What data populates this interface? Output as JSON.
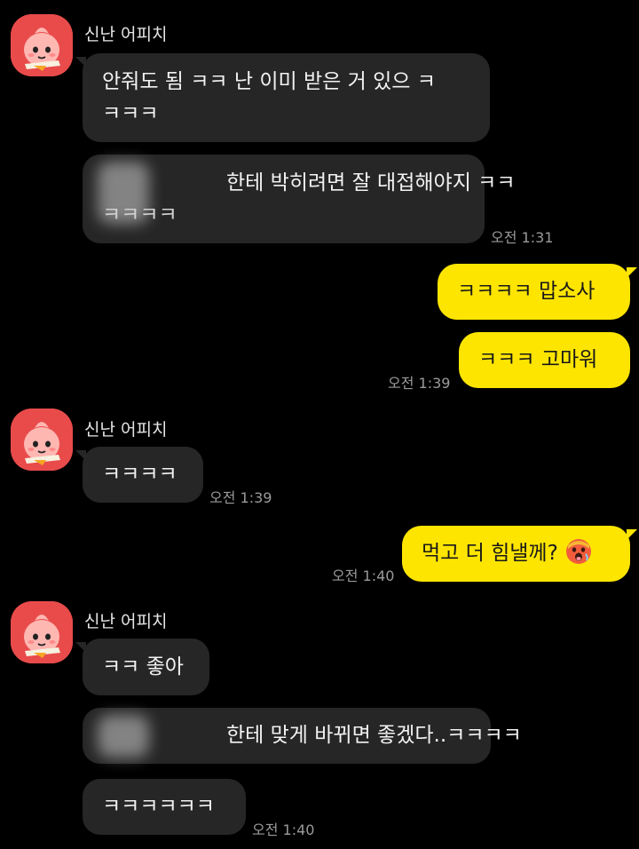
{
  "chat": {
    "sender_name": "신난 어피치",
    "messages": {
      "m1": {
        "line1": "안줘도 됨 ㅋㅋ 난 이미 받은 거 있으 ㅋ",
        "line2": "ㅋㅋㅋ"
      },
      "m2": {
        "line1": "한테 박히려면 잘 대접해야지 ㅋㅋ",
        "line2": "ㅋㅋㅋㅋ"
      },
      "m3": {
        "text": "ㅋㅋㅋㅋ 맙소사"
      },
      "m4": {
        "text": "ㅋㅋㅋ 고마워"
      },
      "m5": {
        "text": "ㅋㅋㅋㅋ"
      },
      "m6": {
        "text": "먹고 더 힘낼께?"
      },
      "m7": {
        "text": "ㅋㅋ 좋아"
      },
      "m8": {
        "text": "한테 맞게 바뀌면 좋겠다..ㅋㅋㅋㅋ"
      },
      "m9": {
        "text": "ㅋㅋㅋㅋㅋㅋ"
      }
    },
    "times": {
      "t1": "오전 1:31",
      "t2": "오전 1:39",
      "t3": "오전 1:39",
      "t4": "오전 1:40",
      "t5": "오전 1:40"
    },
    "colors": {
      "background": "#000000",
      "incoming_bubble": "#262626",
      "outgoing_bubble": "#fee500",
      "avatar_bg": "#e94b4b"
    },
    "icons": {
      "avatar": "apeach-character-avatar",
      "emoji": "hot-face-emoji"
    }
  }
}
